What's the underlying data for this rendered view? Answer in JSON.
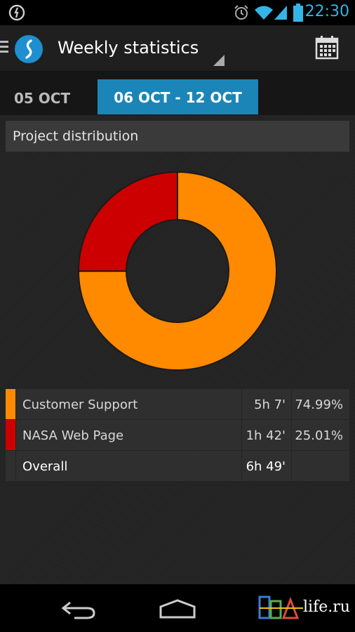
{
  "status_bar": {
    "time": "22:30",
    "icons": [
      "sync-icon",
      "alarm-icon",
      "wifi-icon",
      "signal-icon",
      "battery-icon"
    ],
    "accent_color": "#33b5e5"
  },
  "action_bar": {
    "title": "Weekly statistics",
    "icons": [
      "drawer-icon",
      "app-logo-icon",
      "calendar-icon"
    ]
  },
  "week_tabs": {
    "previous": "05 OCT",
    "current": "06 OCT - 12 OCT",
    "active_color": "#1b85b8"
  },
  "section": {
    "title": "Project distribution"
  },
  "chart_data": {
    "type": "pie",
    "donut": true,
    "labels": [
      "Customer Support",
      "NASA Web Page"
    ],
    "values": [
      74.99,
      25.01
    ],
    "colors": [
      "#ff8a00",
      "#cc0000"
    ]
  },
  "table": {
    "rows": [
      {
        "name": "Customer Support",
        "time": "5h 7'",
        "percent": "74.99%",
        "color": "#ff8a00"
      },
      {
        "name": "NASA Web Page",
        "time": "1h 42'",
        "percent": "25.01%",
        "color": "#cc0000"
      }
    ],
    "overall": {
      "name": "Overall",
      "time": "6h 49'",
      "percent": ""
    }
  },
  "nav_bar": {
    "icons": [
      "back-icon",
      "home-icon"
    ],
    "watermark_text": "life.ru"
  }
}
